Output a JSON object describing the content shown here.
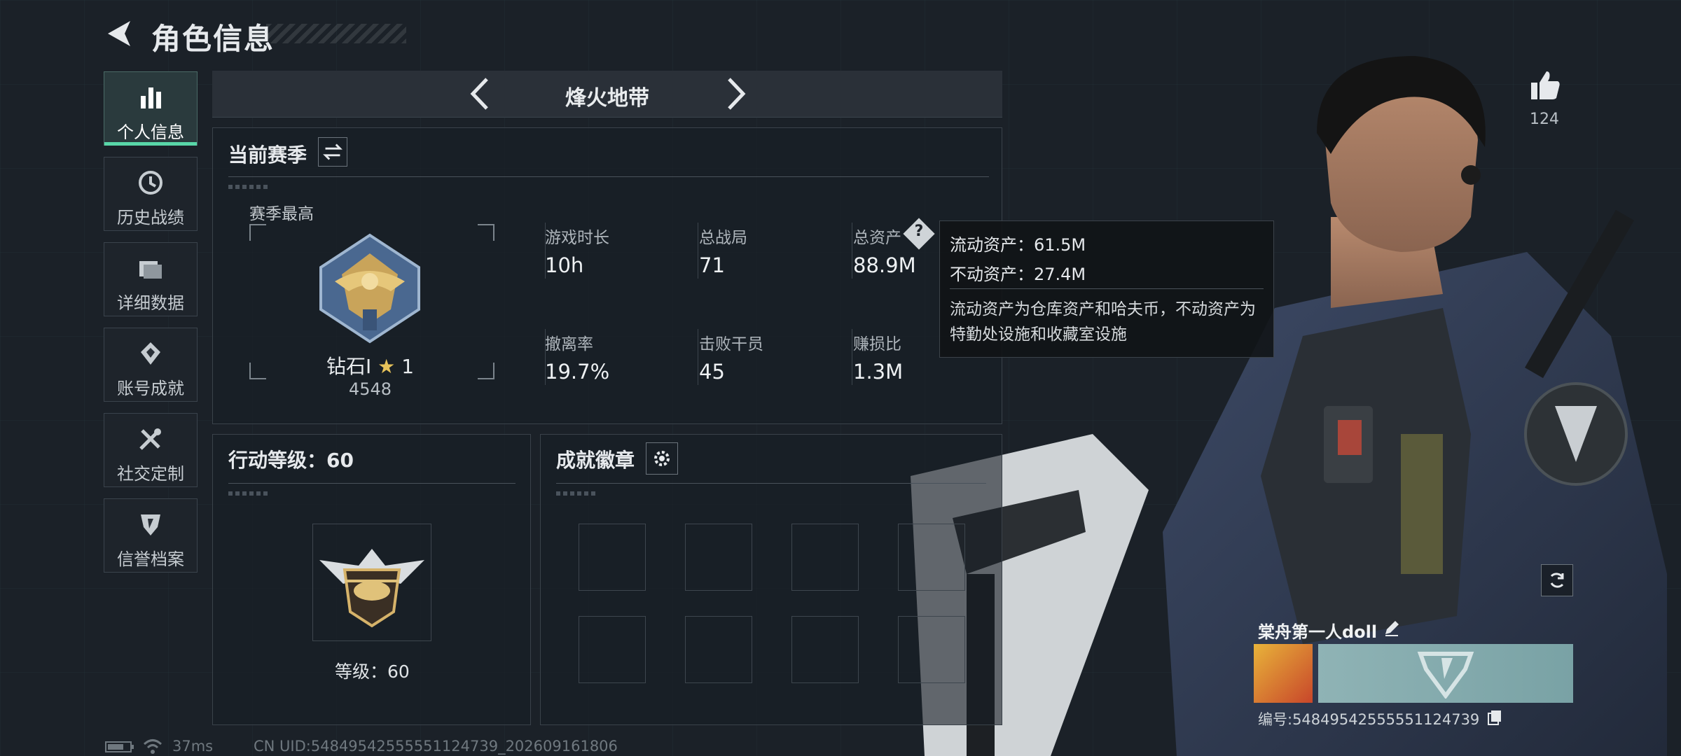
{
  "header": {
    "title": "角色信息"
  },
  "sidebar": {
    "items": [
      {
        "label": "个人信息",
        "icon": "bar-chart-icon",
        "active": true
      },
      {
        "label": "历史战绩",
        "icon": "history-icon",
        "active": false
      },
      {
        "label": "详细数据",
        "icon": "folder-icon",
        "active": false
      },
      {
        "label": "账号成就",
        "icon": "achievement-icon",
        "active": false
      },
      {
        "label": "社交定制",
        "icon": "tools-icon",
        "active": false
      },
      {
        "label": "信誉档案",
        "icon": "shield-emblem-icon",
        "active": false
      }
    ]
  },
  "map_switcher": {
    "current": "烽火地带"
  },
  "season": {
    "title": "当前赛季",
    "best_label": "赛季最高",
    "rank_name": "钻石Ⅰ",
    "rank_stars": "1",
    "rank_points": "4548",
    "stats": [
      {
        "label": "游戏时长",
        "value": "10h"
      },
      {
        "label": "总战局",
        "value": "71"
      },
      {
        "label": "总资产",
        "value": "88.9M"
      },
      {
        "label": "撤离率",
        "value": "19.7%"
      },
      {
        "label": "击败干员",
        "value": "45"
      },
      {
        "label": "赚损比",
        "value": "1.3M"
      }
    ]
  },
  "tooltip": {
    "liquid": "流动资产：61.5M",
    "fixed": "不动资产：27.4M",
    "description": "流动资产为仓库资产和哈夫币，不动资产为特勤处设施和收藏室设施"
  },
  "action_level": {
    "title": "行动等级：60",
    "caption": "等级：60"
  },
  "achievements": {
    "title": "成就徽章",
    "slots": 8
  },
  "likes": {
    "count": "124"
  },
  "player": {
    "name": "棠舟第一人doll",
    "id_text": "编号:5484954255555112473​9"
  },
  "status_bar": {
    "ping": "37ms",
    "uid": "CN UID:5484954255555112473​9_202609161806"
  },
  "colors": {
    "accent": "#58d6a8",
    "background": "#1b2128"
  }
}
